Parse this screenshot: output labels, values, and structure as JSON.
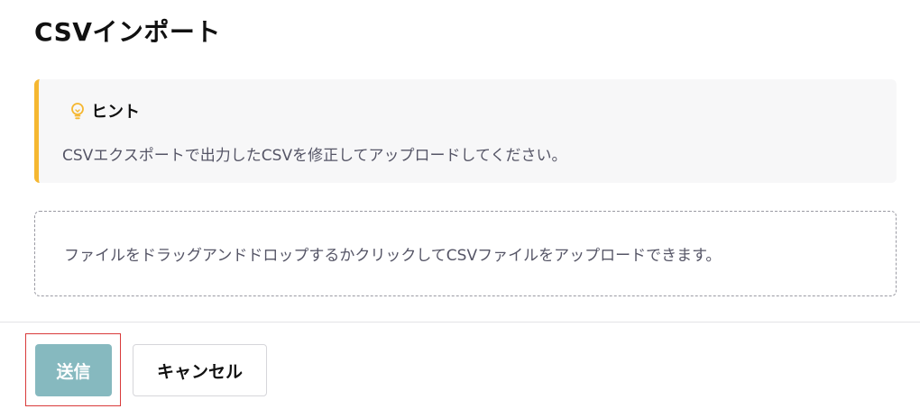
{
  "header": {
    "title": "CSVインポート"
  },
  "hint": {
    "icon": "lightbulb-icon",
    "icon_color": "#f5b731",
    "accent_color": "#f5b731",
    "title": "ヒント",
    "text": "CSVエクスポートで出力したCSVを修正してアップロードしてください。"
  },
  "dropzone": {
    "text": "ファイルをドラッグアンドドロップするかクリックしてCSVファイルをアップロードできます。"
  },
  "actions": {
    "submit_label": "送信",
    "submit_color": "#86b9bf",
    "cancel_label": "キャンセル",
    "highlight_color": "#d93a3a"
  }
}
